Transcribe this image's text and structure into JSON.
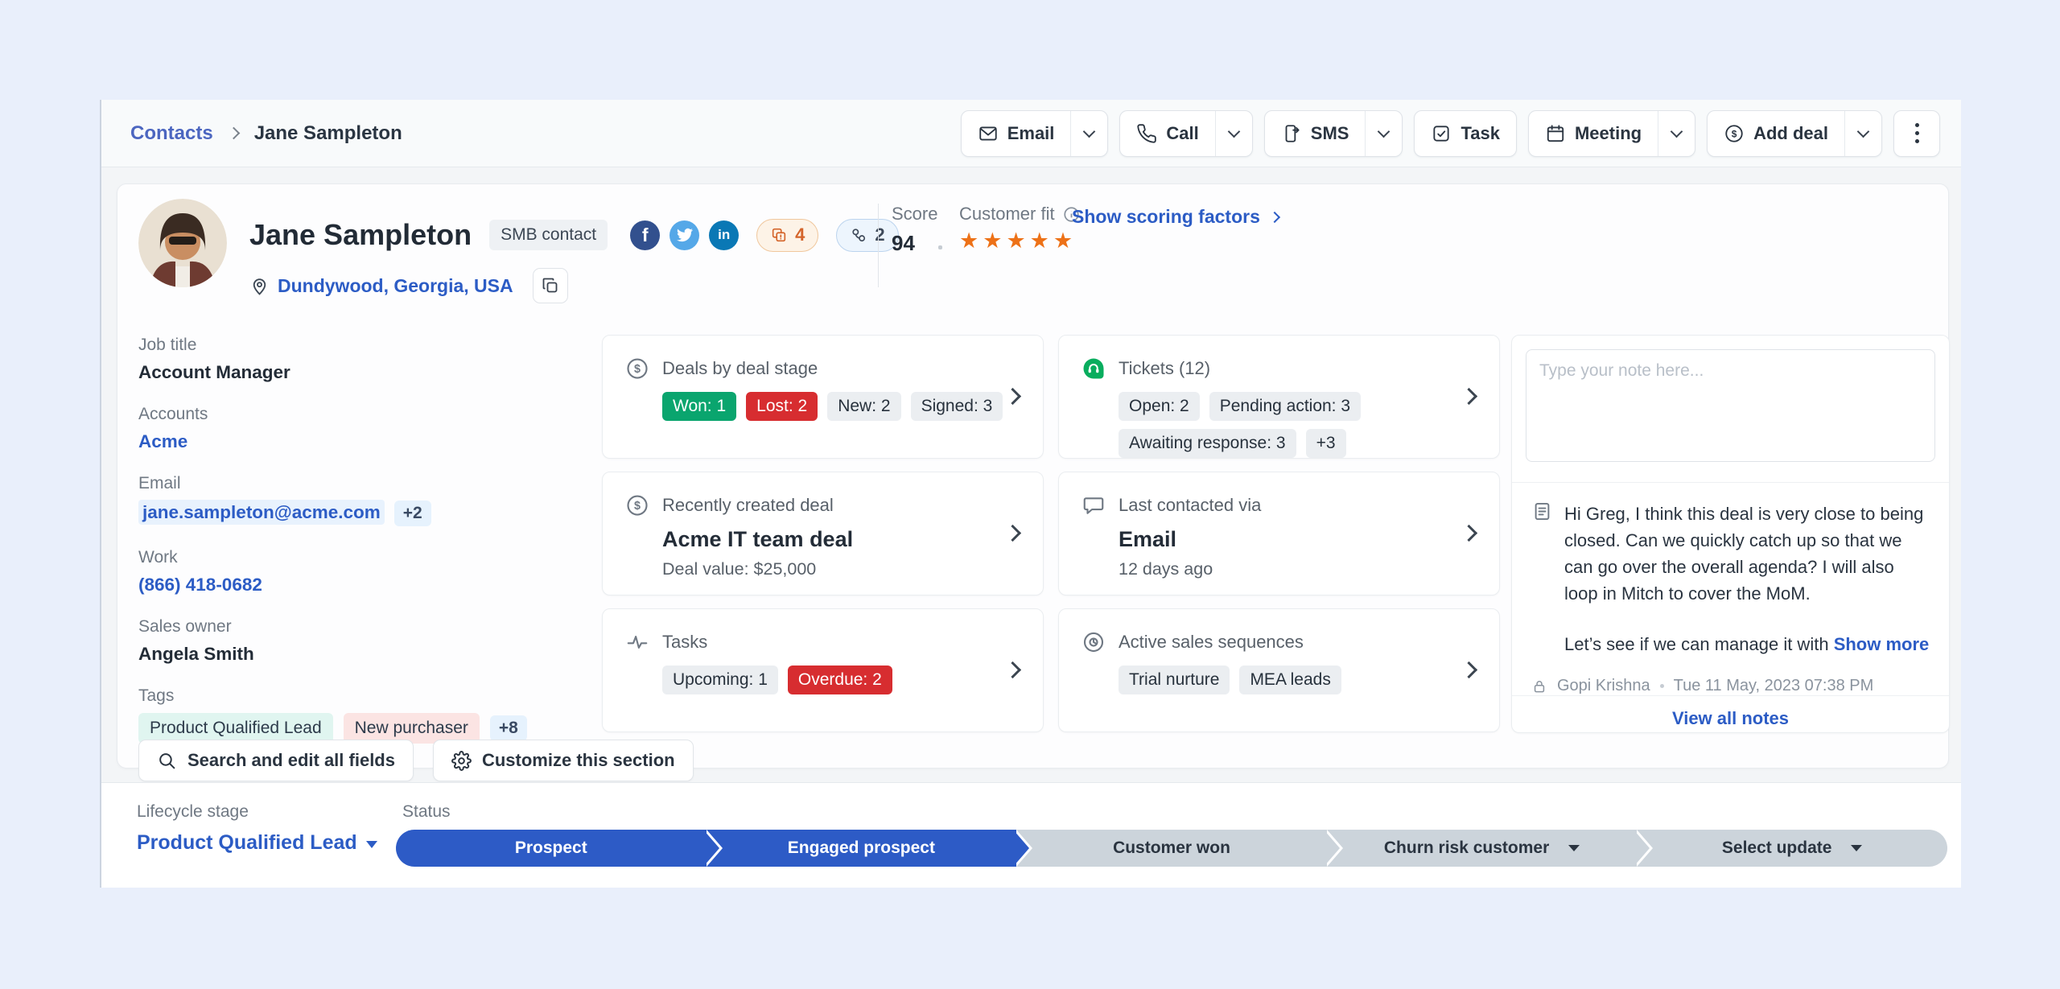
{
  "colors": {
    "brand_blue": "#2c5cc5",
    "active_stage_blue": "#2d5bc6",
    "won_green": "#0aa56e",
    "lost_red": "#d72d30",
    "star_orange": "#ed7117",
    "facebook_blue": "#32508e",
    "twitter_blue": "#55a8e8",
    "linkedin_blue": "#0a78b5",
    "tickets_green": "#09ad5e"
  },
  "breadcrumb": {
    "parent": "Contacts",
    "current": "Jane Sampleton"
  },
  "toolbar": {
    "email": "Email",
    "call": "Call",
    "sms": "SMS",
    "task": "Task",
    "meeting": "Meeting",
    "add_deal": "Add deal"
  },
  "header": {
    "name": "Jane Sampleton",
    "type_badge": "SMB contact",
    "facebook_letter": "f",
    "linkedin_letters": "in",
    "ticket_pill_count": "4",
    "contact_pill_count": "2",
    "score_label": "Score",
    "score_value": "94",
    "fit_label": "Customer fit",
    "scoring_link": "Show scoring factors",
    "location": "Dundywood, Georgia, USA"
  },
  "details": {
    "job_title": {
      "label": "Job title",
      "value": "Account Manager"
    },
    "accounts": {
      "label": "Accounts",
      "value": "Acme"
    },
    "email": {
      "label": "Email",
      "value": "jane.sampleton@acme.com",
      "extra": "+2"
    },
    "work": {
      "label": "Work",
      "value": "(866) 418-0682"
    },
    "sales_owner": {
      "label": "Sales owner",
      "value": "Angela Smith"
    },
    "tags": {
      "label": "Tags",
      "tag1": "Product Qualified Lead",
      "tag2": "New purchaser",
      "more": "+8"
    }
  },
  "cards": {
    "deals": {
      "title": "Deals by deal stage",
      "won": "Won: 1",
      "lost": "Lost: 2",
      "new": "New: 2",
      "signed": "Signed: 3"
    },
    "tickets": {
      "title": "Tickets (12)",
      "open": "Open: 2",
      "pending": "Pending action: 3",
      "awaiting": "Awaiting response: 3",
      "more": "+3"
    },
    "recent_deal": {
      "title": "Recently created deal",
      "name": "Acme IT team deal",
      "value": "Deal value: $25,000"
    },
    "last_contacted": {
      "title": "Last contacted via",
      "channel": "Email",
      "when": "12 days ago"
    },
    "tasks": {
      "title": "Tasks",
      "upcoming": "Upcoming: 1",
      "overdue": "Overdue: 2"
    },
    "sequences": {
      "title": "Active sales sequences",
      "seq1": "Trial nurture",
      "seq2": "MEA leads"
    }
  },
  "notes": {
    "placeholder": "Type your note here...",
    "body": "Hi Greg, I think this deal is very close to being closed. Can we quickly catch up so that we can go over the overall agenda? I will also loop in Mitch to cover the MoM.",
    "body2": "Let’s see if we can manage it with",
    "show_more": "Show more",
    "author": "Gopi Krishna",
    "timestamp": "Tue 11 May, 2023 07:38 PM",
    "view_all": "View all notes"
  },
  "section_actions": {
    "search": "Search and edit all fields",
    "customize": "Customize this section"
  },
  "lifecycle": {
    "label": "Lifecycle stage",
    "value": "Product Qualified Lead",
    "status_label": "Status",
    "stages": [
      {
        "label": "Prospect",
        "active": true,
        "dropdown": false
      },
      {
        "label": "Engaged prospect",
        "active": true,
        "dropdown": false
      },
      {
        "label": "Customer won",
        "active": false,
        "dropdown": false
      },
      {
        "label": "Churn risk customer",
        "active": false,
        "dropdown": true
      },
      {
        "label": "Select update",
        "active": false,
        "dropdown": true
      }
    ]
  }
}
